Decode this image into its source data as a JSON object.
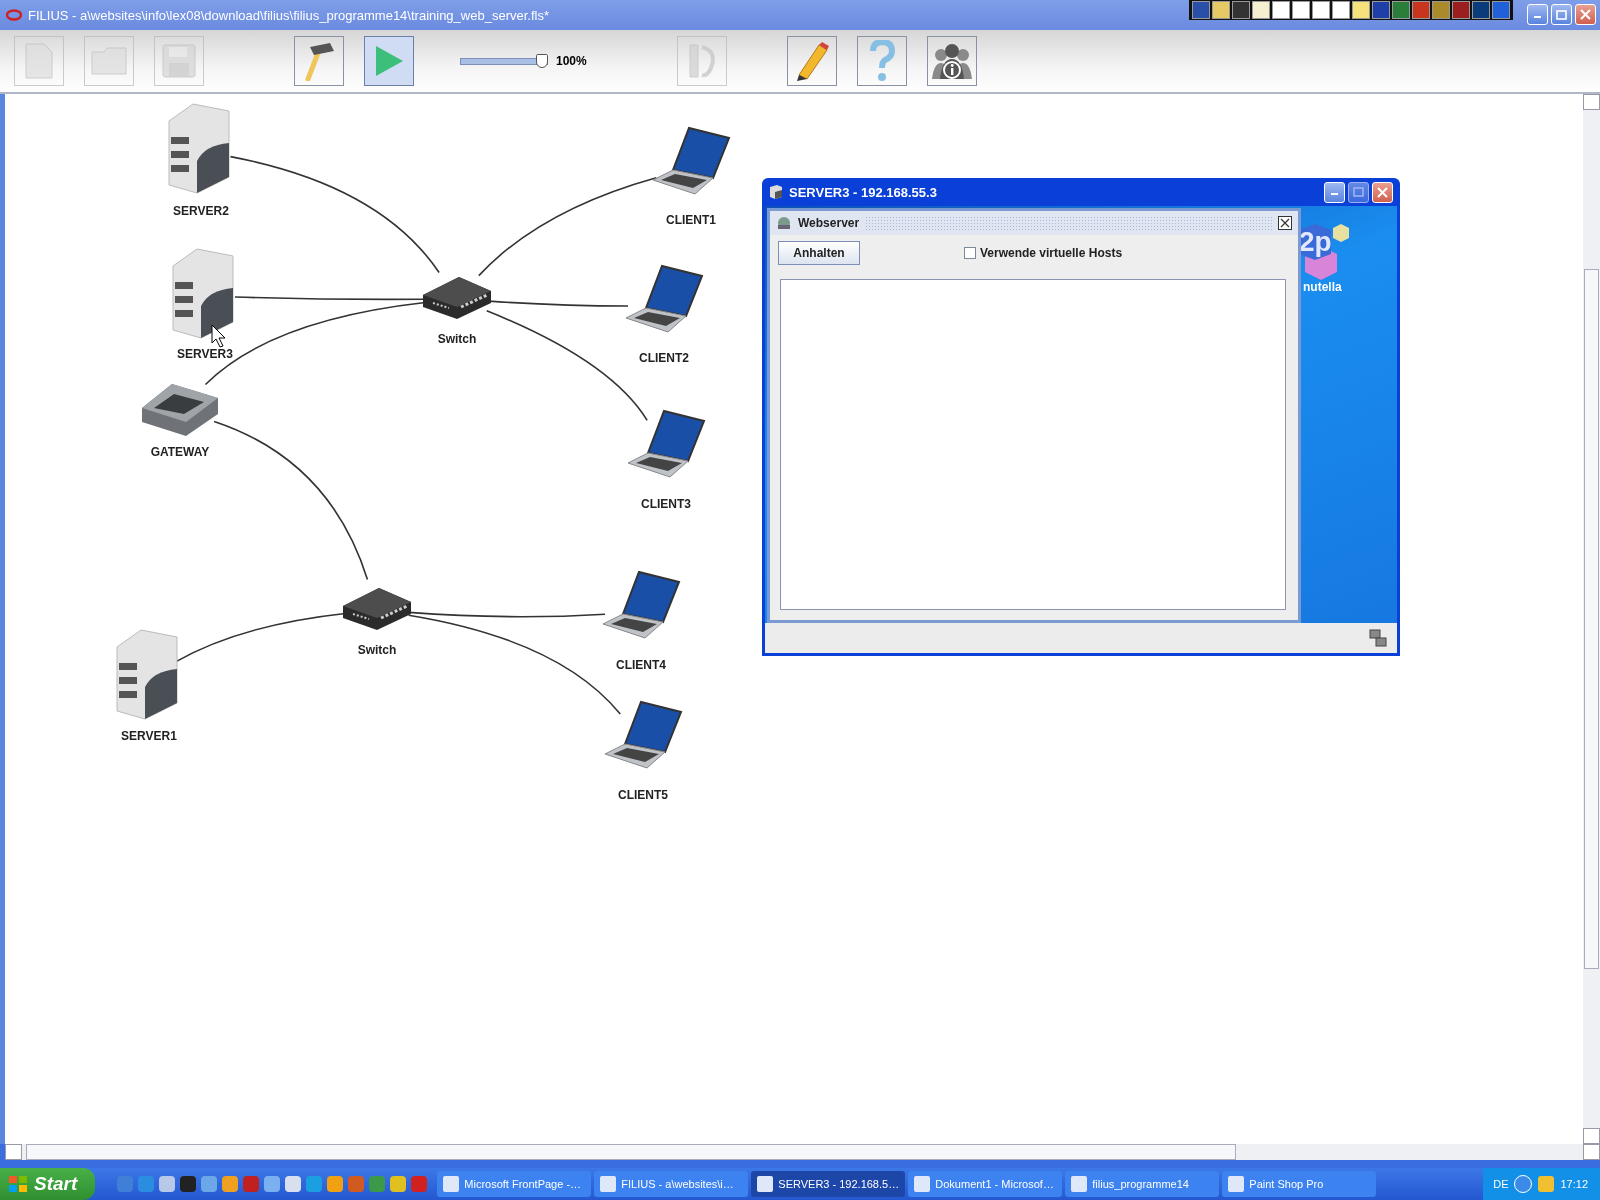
{
  "window": {
    "title": "FILIUS - a\\websites\\info\\lex08\\download\\filius\\filius_programme14\\training_web_server.fls*"
  },
  "toolbar": {
    "buttons": [
      {
        "kind": "new",
        "disabled": true,
        "selected": false
      },
      {
        "kind": "open",
        "disabled": true,
        "selected": false
      },
      {
        "kind": "save",
        "disabled": true,
        "selected": false
      },
      {
        "kind": "design",
        "disabled": false,
        "selected": false
      },
      {
        "kind": "simulate",
        "disabled": false,
        "selected": true
      },
      {
        "kind": "tools",
        "disabled": true,
        "selected": false
      },
      {
        "kind": "edit",
        "disabled": false,
        "selected": false
      },
      {
        "kind": "help",
        "disabled": false,
        "selected": false
      },
      {
        "kind": "info",
        "disabled": false,
        "selected": false
      }
    ],
    "zoom": {
      "level": 0.94,
      "reading": "100%"
    }
  },
  "nodes": [
    {
      "kind": "server",
      "label": "SERVER2"
    },
    {
      "kind": "laptop",
      "label": "CLIENT1"
    },
    {
      "kind": "server",
      "label": "SERVER3"
    },
    {
      "kind": "switch",
      "label": "Switch"
    },
    {
      "kind": "laptop",
      "label": "CLIENT2"
    },
    {
      "kind": "router",
      "label": "GATEWAY"
    },
    {
      "kind": "laptop",
      "label": "CLIENT3"
    },
    {
      "kind": "switch",
      "label": "Switch"
    },
    {
      "kind": "laptop",
      "label": "CLIENT4"
    },
    {
      "kind": "server",
      "label": "SERVER1"
    },
    {
      "kind": "laptop",
      "label": "CLIENT5"
    }
  ],
  "dialog": {
    "title": "SERVER3 - 192.168.55.3",
    "panel": {
      "title": "Webserver",
      "button": "Anhalten",
      "checkbox": {
        "label": "Verwende virtuelle Hosts",
        "checked": false
      }
    },
    "desktop_icon": {
      "text": "2p",
      "label": "nutella"
    }
  },
  "taskbar": {
    "start": "Start",
    "tasks": [
      {
        "label": "Microsoft FrontPage -…",
        "selected": false
      },
      {
        "label": "FILIUS - a\\websites\\i…",
        "selected": false
      },
      {
        "label": "SERVER3 - 192.168.5…",
        "selected": true
      },
      {
        "label": "Dokument1 - Microsof…",
        "selected": false
      },
      {
        "label": "filius_programme14",
        "selected": false
      },
      {
        "label": "Paint Shop Pro",
        "selected": false
      }
    ],
    "tray": {
      "language": "DE",
      "time": "17:12"
    }
  }
}
